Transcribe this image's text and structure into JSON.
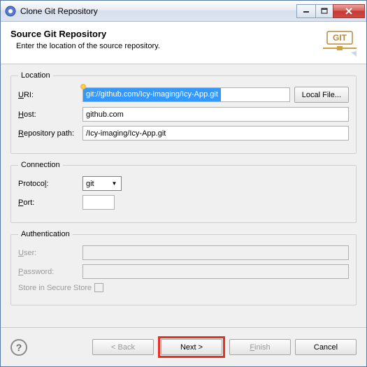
{
  "window": {
    "title": "Clone Git Repository"
  },
  "header": {
    "title": "Source Git Repository",
    "subtitle": "Enter the location of the source repository."
  },
  "location": {
    "legend": "Location",
    "uri_label": "URI:",
    "uri_value": "git://github.com/Icy-imaging/Icy-App.git",
    "local_file": "Local File...",
    "host_label": "Host:",
    "host_value": "github.com",
    "repo_path_label": "Repository path:",
    "repo_path_value": "/Icy-imaging/Icy-App.git"
  },
  "connection": {
    "legend": "Connection",
    "protocol_label": "Protocol:",
    "protocol_value": "git",
    "port_label": "Port:",
    "port_value": ""
  },
  "auth": {
    "legend": "Authentication",
    "user_label": "User:",
    "user_value": "",
    "password_label": "Password:",
    "password_value": "",
    "store_label": "Store in Secure Store"
  },
  "buttons": {
    "back": "< Back",
    "next": "Next >",
    "finish": "Finish",
    "cancel": "Cancel",
    "help": "?"
  }
}
